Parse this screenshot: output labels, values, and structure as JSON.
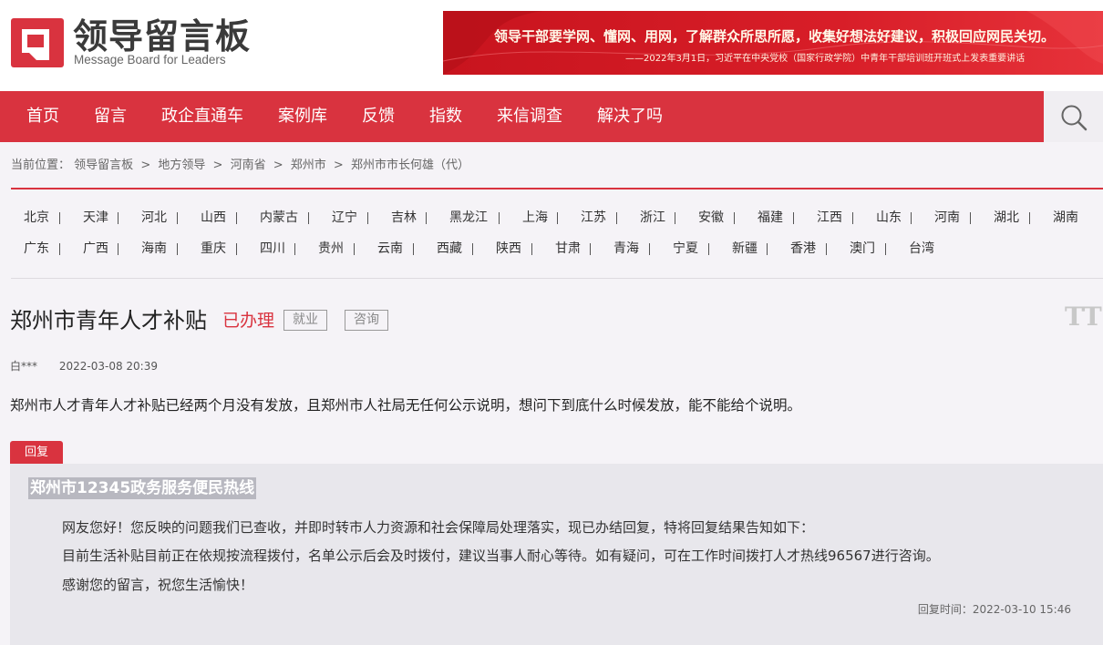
{
  "header": {
    "logo_title": "领导留言板",
    "logo_subtitle": "Message Board for Leaders",
    "banner_line1": "领导干部要学网、懂网、用网，了解群众所思所愿，收集好想法好建议，积极回应网民关切。",
    "banner_line2": "——2022年3月1日，习近平在中央党校（国家行政学院）中青年干部培训班开班式上发表重要讲话"
  },
  "nav": {
    "items": [
      "首页",
      "留言",
      "政企直通车",
      "案例库",
      "反馈",
      "指数",
      "来信调查",
      "解决了吗"
    ],
    "search_icon": "search-icon"
  },
  "breadcrumb": {
    "label": "当前位置：",
    "items": [
      "领导留言板",
      "地方领导",
      "河南省",
      "郑州市",
      "郑州市市长何雄（代）"
    ],
    "separator": ">"
  },
  "regions": {
    "row1": [
      "北京",
      "天津",
      "河北",
      "山西",
      "内蒙古",
      "辽宁",
      "吉林",
      "黑龙江",
      "上海",
      "江苏",
      "浙江",
      "安徽",
      "福建",
      "江西",
      "山东",
      "河南",
      "湖北",
      "湖南"
    ],
    "row2": [
      "广东",
      "广西",
      "海南",
      "重庆",
      "四川",
      "贵州",
      "云南",
      "西藏",
      "陕西",
      "甘肃",
      "青海",
      "宁夏",
      "新疆",
      "香港",
      "澳门",
      "台湾"
    ]
  },
  "message": {
    "title": "郑州市青年人才补贴",
    "status": "已办理",
    "tags": [
      "就业",
      "咨询"
    ],
    "font_toggle": "TT",
    "author": "白***",
    "time": "2022-03-08 20:39",
    "content": "郑州市人才青年人才补贴已经两个月没有发放，且郑州市人社局无任何公示说明，想问下到底什么时候发放，能不能给个说明。"
  },
  "reply": {
    "tab_label": "回复",
    "replier": "郑州市12345政务服务便民热线",
    "lines": [
      "网友您好！您反映的问题我们已查收，并即时转市人力资源和社会保障局处理落实，现已办结回复，特将回复结果告知如下：",
      "目前生活补贴目前正在依规按流程拨付，名单公示后会及时拨付，建议当事人耐心等待。如有疑问，可在工作时间拨打人才热线96567进行咨询。",
      "感谢您的留言，祝您生活愉快！"
    ],
    "time": "回复时间：2022-03-10 15:46"
  },
  "colors": {
    "brand_red": "#d9333f",
    "nav_bg": "#d9333f",
    "page_bg": "#f5f3f7",
    "reply_bg": "#e8e7ec"
  }
}
